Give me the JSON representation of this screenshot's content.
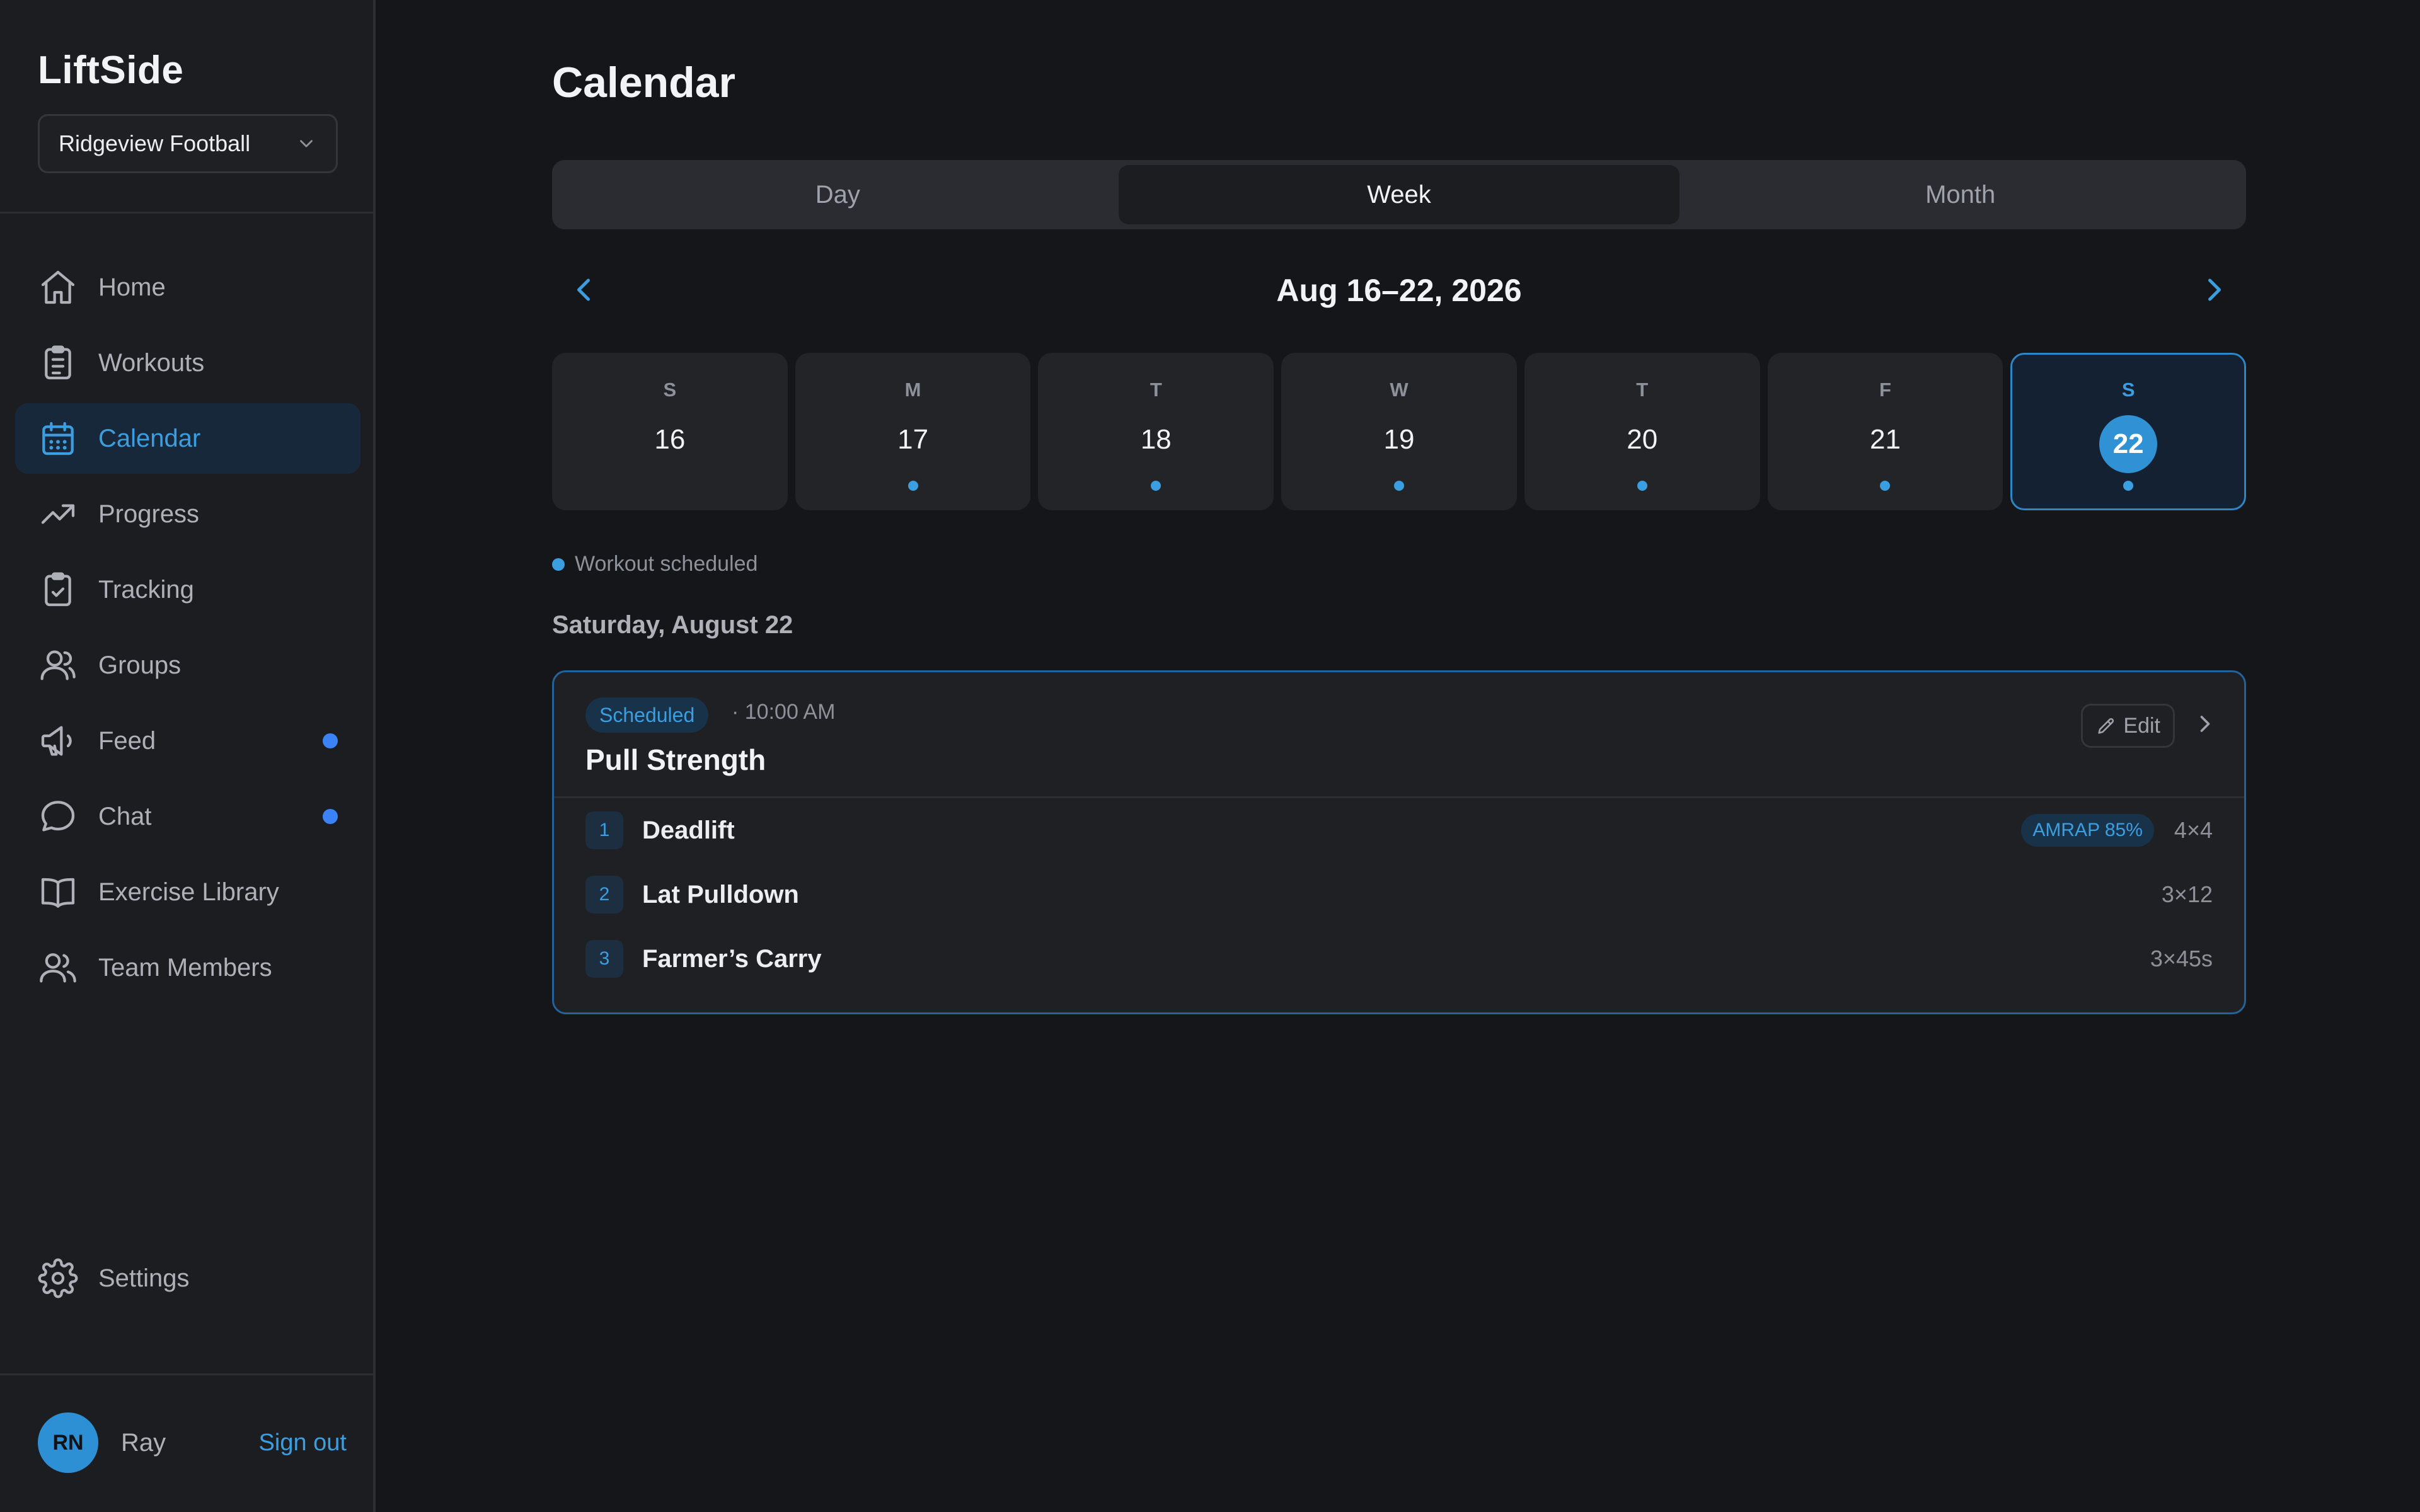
{
  "app": {
    "name": "LiftSide"
  },
  "team_select": {
    "value": "Ridgeview Football"
  },
  "nav": [
    {
      "key": "home",
      "label": "Home",
      "icon": "home-icon",
      "active": false,
      "dot": false
    },
    {
      "key": "workouts",
      "label": "Workouts",
      "icon": "clipboard-list-icon",
      "active": false,
      "dot": false
    },
    {
      "key": "calendar",
      "label": "Calendar",
      "icon": "calendar-icon",
      "active": true,
      "dot": false
    },
    {
      "key": "progress",
      "label": "Progress",
      "icon": "trending-up-icon",
      "active": false,
      "dot": false
    },
    {
      "key": "tracking",
      "label": "Tracking",
      "icon": "clipboard-check-icon",
      "active": false,
      "dot": false
    },
    {
      "key": "groups",
      "label": "Groups",
      "icon": "users-icon",
      "active": false,
      "dot": false
    },
    {
      "key": "feed",
      "label": "Feed",
      "icon": "megaphone-icon",
      "active": false,
      "dot": true
    },
    {
      "key": "chat",
      "label": "Chat",
      "icon": "chat-bubble-icon",
      "active": false,
      "dot": true
    },
    {
      "key": "exercise-library",
      "label": "Exercise Library",
      "icon": "book-open-icon",
      "active": false,
      "dot": false
    },
    {
      "key": "team-members",
      "label": "Team Members",
      "icon": "team-icon",
      "active": false,
      "dot": false
    }
  ],
  "settings": {
    "label": "Settings",
    "icon": "gear-icon"
  },
  "user": {
    "initials": "RN",
    "name": "Ray",
    "sign_out": "Sign out"
  },
  "page": {
    "title": "Calendar"
  },
  "view_toggle": {
    "options": [
      "Day",
      "Week",
      "Month"
    ],
    "selected": "Week"
  },
  "range": {
    "label": "Aug 16–22, 2026"
  },
  "days": [
    {
      "dow": "S",
      "date": "16",
      "has_workout": false,
      "selected": false
    },
    {
      "dow": "M",
      "date": "17",
      "has_workout": true,
      "selected": false
    },
    {
      "dow": "T",
      "date": "18",
      "has_workout": true,
      "selected": false
    },
    {
      "dow": "W",
      "date": "19",
      "has_workout": true,
      "selected": false
    },
    {
      "dow": "T",
      "date": "20",
      "has_workout": true,
      "selected": false
    },
    {
      "dow": "F",
      "date": "21",
      "has_workout": true,
      "selected": false
    },
    {
      "dow": "S",
      "date": "22",
      "has_workout": true,
      "selected": true
    }
  ],
  "legend": {
    "label": "Workout scheduled"
  },
  "selected_date": {
    "label": "Saturday, August 22"
  },
  "workout": {
    "status": "Scheduled",
    "time": "· 10:00 AM",
    "title": "Pull Strength",
    "edit_label": "Edit",
    "exercises": [
      {
        "num": "1",
        "name": "Deadlift",
        "tag": "AMRAP 85%",
        "sets": "4×4"
      },
      {
        "num": "2",
        "name": "Lat Pulldown",
        "tag": "",
        "sets": "3×12"
      },
      {
        "num": "3",
        "name": "Farmer’s Carry",
        "tag": "",
        "sets": "3×45s"
      }
    ]
  },
  "colors": {
    "accent": "#3b9ee0",
    "notify_dot": "#3b82f6",
    "background": "#151619",
    "sidebar": "#1c1d21"
  }
}
